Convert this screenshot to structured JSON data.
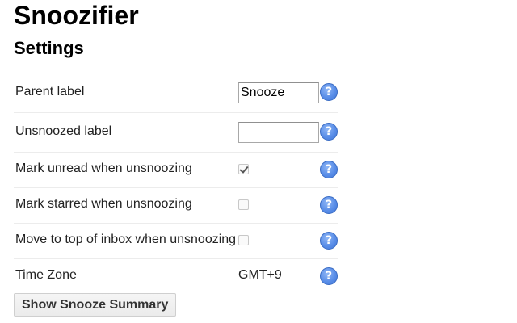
{
  "app": {
    "title": "Snoozifier"
  },
  "page": {
    "title": "Settings"
  },
  "settings": {
    "parent_label": {
      "label": "Parent label",
      "value": "Snooze",
      "help_glyph": "?",
      "help_icon": "question-mark-icon"
    },
    "unsnoozed_label": {
      "label": "Unsnoozed label",
      "value": "",
      "help_glyph": "?",
      "help_icon": "question-mark-icon"
    },
    "mark_unread": {
      "label": "Mark unread when unsnoozing",
      "checked": true,
      "help_glyph": "?",
      "help_icon": "question-mark-icon"
    },
    "mark_starred": {
      "label": "Mark starred when unsnoozing",
      "checked": false,
      "help_glyph": "?",
      "help_icon": "question-mark-icon"
    },
    "move_to_top": {
      "label": "Move to top of inbox when unsnoozing",
      "checked": false,
      "help_glyph": "?",
      "help_icon": "question-mark-icon"
    },
    "time_zone": {
      "label": "Time Zone",
      "value": "GMT+9",
      "help_glyph": "?",
      "help_icon": "question-mark-icon"
    }
  },
  "actions": {
    "show_summary_label": "Show Snooze Summary"
  },
  "colors": {
    "help_icon_fill": "#5a8ee8",
    "row_divider": "#ececec",
    "button_background": "#f0f0f0"
  }
}
